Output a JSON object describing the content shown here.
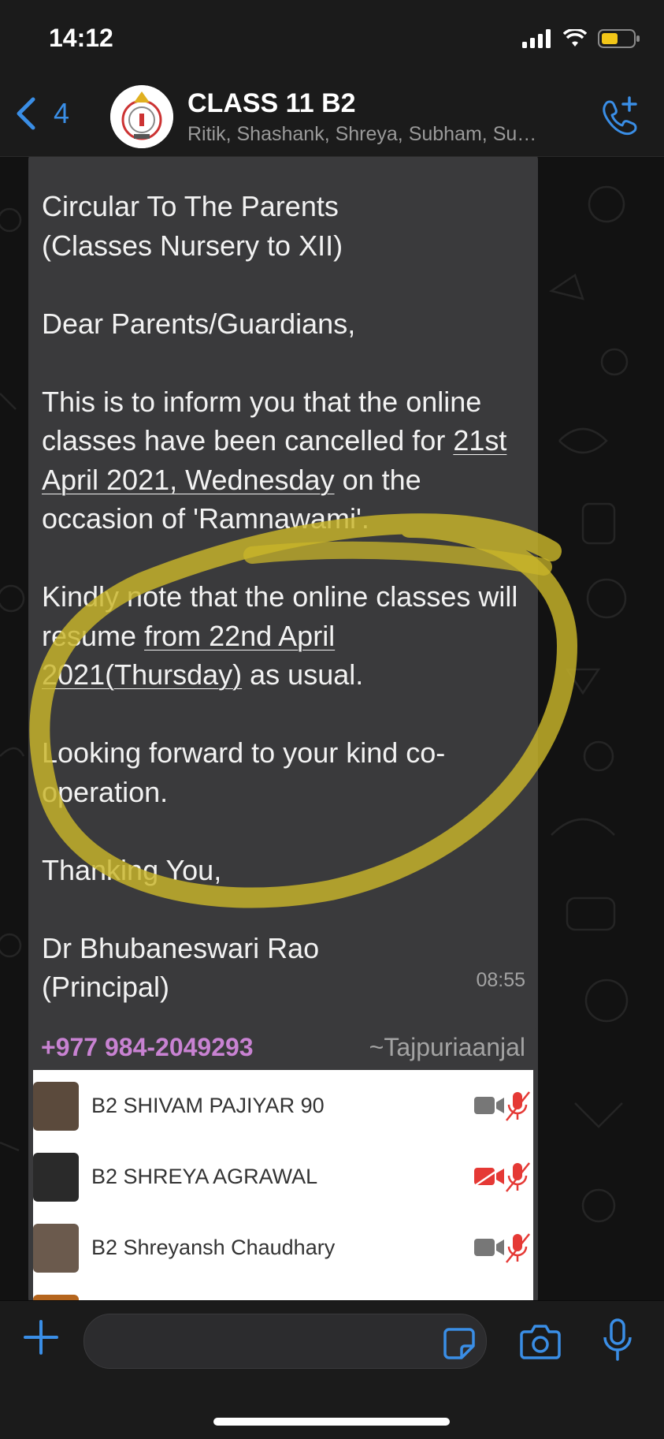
{
  "status": {
    "time": "14:12",
    "icons": [
      "signal-icon",
      "wifi-icon",
      "battery-icon"
    ]
  },
  "header": {
    "back_count": "4",
    "title": "CLASS 11 B2",
    "members": "Ritik, Shashank, Shreya, Subham, Su…"
  },
  "message": {
    "line1": "Circular To The Parents",
    "line2": "(Classes Nursery to XII)",
    "greeting": "Dear Parents/Guardians,",
    "p1_a": "This is to inform you that the online classes have been cancelled for",
    "p1_date": "21st April 2021, Wednesday",
    "p1_b": "on the occasion of 'Ramnawami'.",
    "p2_a": "Kindly note that the online classes will resume",
    "p2_date": "from 22nd April 2021(Thursday)",
    "p2_b": "as usual.",
    "p3": "Looking forward to your kind co-operation.",
    "p4": "Thanking You,",
    "sign_name": "Dr Bhubaneswari Rao",
    "sign_title": "(Principal)",
    "time": "08:55"
  },
  "message2": {
    "sender_phone": "+977 984-2049293",
    "sender_alias": "~Tajpuriaanjal",
    "participants": [
      {
        "name": "B2 SHIVAM PAJIYAR 90",
        "camera_off": false,
        "muted": true
      },
      {
        "name": "B2 SHREYA AGRAWAL",
        "camera_off": true,
        "muted": true
      },
      {
        "name": "B2 Shreyansh Chaudhary",
        "camera_off": false,
        "muted": true
      }
    ]
  },
  "colors": {
    "accent": "#3a8ee6",
    "highlight": "#c9b62a",
    "sender": "#c882d2",
    "mute_red": "#e53935"
  }
}
